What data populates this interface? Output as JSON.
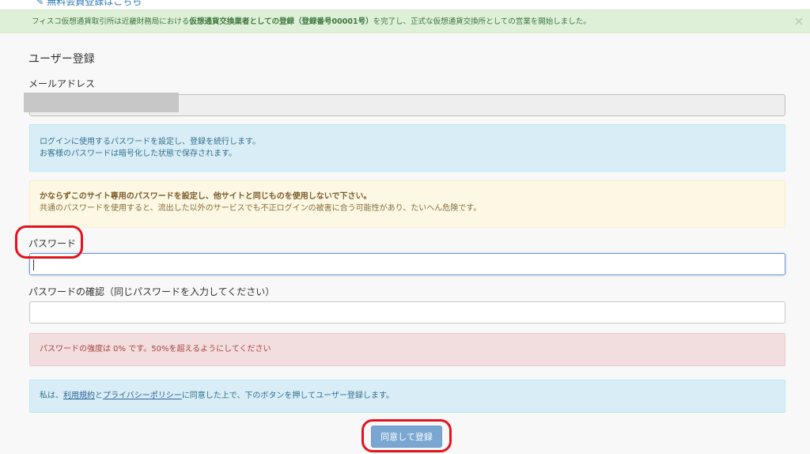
{
  "top": {
    "link_label": "無料会員登録はこちら",
    "notice_prefix": "フィスコ仮想通貨取引所は近畿財務局における",
    "notice_bold": "仮想通貨交換業者としての登録（登録番号00001号）",
    "notice_suffix": "を完了し、正式な仮想通貨交換所としての営業を開始しました。",
    "close_glyph": "×"
  },
  "form": {
    "title": "ユーザー登録",
    "email_label": "メールアドレス",
    "info_line1": "ログインに使用するパスワードを設定し、登録を続行します。",
    "info_line2": "お客様のパスワードは暗号化した状態で保存されます。",
    "warning_bold": "かならずこのサイト専用のパスワードを設定し、他サイトと同じものを使用しないで下さい。",
    "warning_text": "共通のパスワードを使用すると、流出した以外のサービスでも不正ログインの被害に合う可能性があり、たいへん危険です。",
    "password_label": "パスワード",
    "confirm_label": "パスワードの確認（同じパスワードを入力してください）",
    "strength_text": "パスワードの強度は 0% です。50%を超えるようにしてください",
    "agree_prefix": "私は、",
    "terms_link": "利用規約",
    "agree_and": "と",
    "privacy_link": "プライバシーポリシー",
    "agree_suffix": "に同意した上で、下のボタンを押してユーザー登録します。",
    "submit_label": "同意して登録"
  },
  "colors": {
    "accent": "#7aa7d1",
    "annotation_red": "#e1141e"
  }
}
